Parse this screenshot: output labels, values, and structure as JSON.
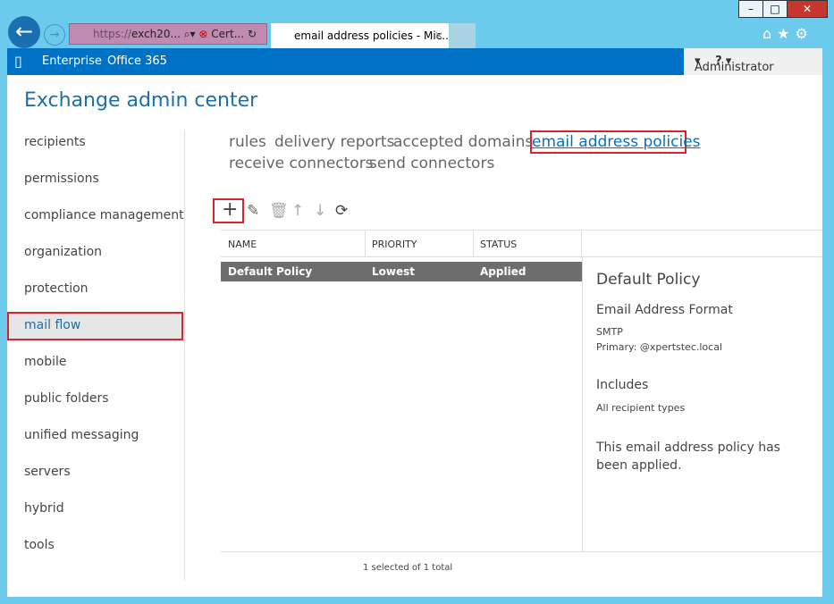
{
  "browser": {
    "address_prefix": "https://",
    "address_host": "exch20...",
    "cert": "Cert...",
    "tab_title": "email address policies - Mic...",
    "window_buttons": [
      "–",
      "□",
      "✕"
    ]
  },
  "nav": {
    "enterprise": "Enterprise",
    "office365": "Office 365",
    "user": "Administrator",
    "help": "?"
  },
  "app_title": "Exchange admin center",
  "sidebar": [
    "recipients",
    "permissions",
    "compliance management",
    "organization",
    "protection",
    "mail flow",
    "mobile",
    "public folders",
    "unified messaging",
    "servers",
    "hybrid",
    "tools"
  ],
  "tabs": [
    "rules",
    "delivery reports",
    "accepted domains",
    "email address policies",
    "receive connectors",
    "send connectors"
  ],
  "table": {
    "headers": [
      "NAME",
      "PRIORITY",
      "STATUS"
    ],
    "rows": [
      [
        "Default Policy",
        "Lowest",
        "Applied"
      ]
    ]
  },
  "details": {
    "title": "Default Policy",
    "format_heading": "Email Address Format",
    "format_type": "SMTP",
    "format_primary": "Primary: @xpertstec.local",
    "includes_heading": "Includes",
    "includes_value": "All recipient types",
    "status_text": "This email address policy has been applied."
  },
  "footer": "1 selected of 1 total"
}
